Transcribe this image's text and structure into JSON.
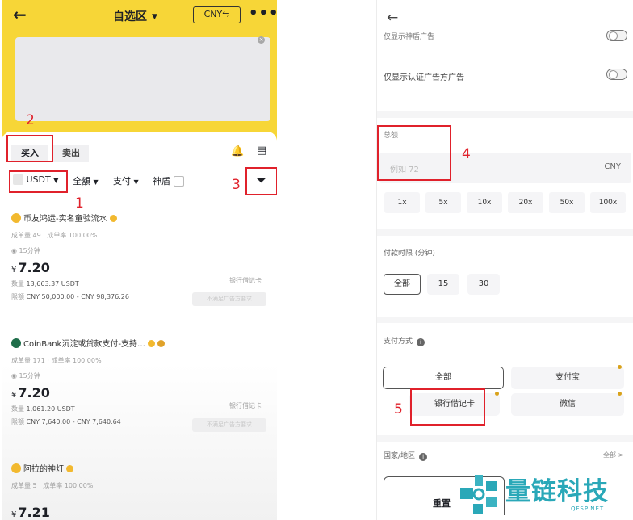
{
  "left": {
    "header": {
      "back_icon": "back-arrow-icon",
      "title": "自选区",
      "currency": "CNY⇋",
      "more_icon": "more-icon"
    },
    "tabs": {
      "buy": "买入",
      "sell": "卖出"
    },
    "filters": {
      "coin": "USDT",
      "amount": "全額",
      "payment": "支付",
      "shield": "神盾"
    },
    "annotations": {
      "a1": "1",
      "a2": "2",
      "a3": "3"
    },
    "ads": [
      {
        "name": "币友鸿运-实名童验流水",
        "stats": "成单量 49 · 成单率 100.00%",
        "time": "15分钟",
        "currency_symbol": "¥",
        "price": "7.20",
        "quantity_label": "数量",
        "quantity": "13,663.37 USDT",
        "limit_label": "限额",
        "limit": "CNY 50,000.00 - CNY 98,376.26",
        "payment": "银行借记卡",
        "button": "不满足广告方要求"
      },
      {
        "name": "CoinBank沉淀或贷款支付-支持…",
        "stats": "成单量 171 · 成单率 100.00%",
        "time": "15分钟",
        "currency_symbol": "¥",
        "price": "7.20",
        "quantity_label": "数量",
        "quantity": "1,061.20 USDT",
        "limit_label": "限额",
        "limit": "CNY 7,640.00 - CNY 7,640.64",
        "payment": "银行借记卡",
        "button": "不满足广告方要求"
      },
      {
        "name": "阿拉的神灯",
        "stats": "成单量 5 · 成单率 100.00%",
        "currency_symbol": "¥",
        "price": "7.21"
      }
    ]
  },
  "right": {
    "back_icon": "back-arrow-icon",
    "only_show_label_partial": "仅显示神盾广告",
    "only_verified_label": "仅显示认证广告方广告",
    "amount_label": "总额",
    "amount_placeholder": "例如 72",
    "amount_currency": "CNY",
    "multipliers": [
      "1x",
      "5x",
      "10x",
      "20x",
      "50x",
      "100x"
    ],
    "pay_time_label": "付款时限 (分钟)",
    "pay_time_options": [
      "全部",
      "15",
      "30"
    ],
    "pay_method_label": "支付方式",
    "pay_methods": [
      "全部",
      "支付宝",
      "银行借记卡",
      "微信"
    ],
    "region_label": "国家/地区",
    "region_value": "全部 >",
    "reset_button": "重置",
    "annotations": {
      "a4": "4",
      "a5": "5"
    }
  },
  "watermark": {
    "text": "量链科技",
    "sub": "QFSP.NET"
  },
  "colors": {
    "yellow": "#f7d637",
    "red_annotation": "#e0212b",
    "watermark": "#2aa8b8"
  }
}
